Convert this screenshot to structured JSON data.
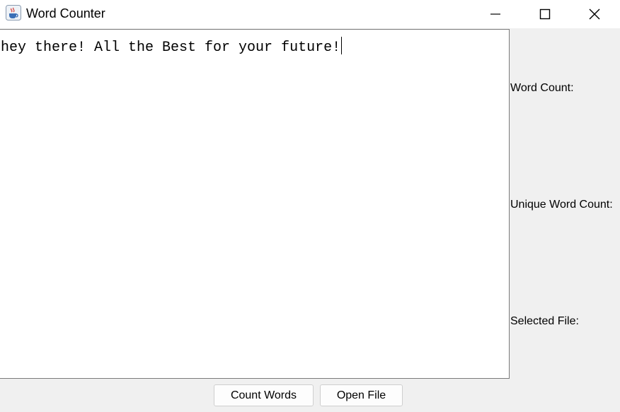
{
  "window": {
    "title": "Word Counter",
    "controls": [
      "minimize-icon",
      "maximize-icon",
      "close-icon"
    ]
  },
  "editor": {
    "text": "hey there! All the Best for your future!"
  },
  "stats": {
    "word_count_label": "Word Count:",
    "unique_word_count_label": "Unique Word Count:",
    "selected_file_label": "Selected File:"
  },
  "buttons": {
    "count_words": "Count Words",
    "open_file": "Open File"
  }
}
